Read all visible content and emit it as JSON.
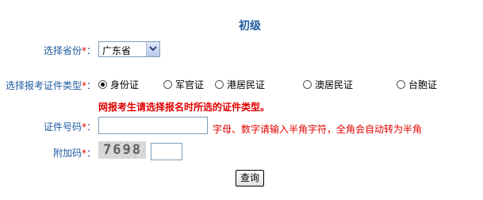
{
  "title": "初级",
  "province": {
    "label": "选择省份",
    "required_mark": "*",
    "colon": "：",
    "value": "广东省"
  },
  "id_type": {
    "label": "选择报考证件类型",
    "required_mark": "*",
    "colon": "：",
    "options": [
      {
        "label": "身份证",
        "selected": true
      },
      {
        "label": "军官证",
        "selected": false
      },
      {
        "label": "港居民证",
        "selected": false
      },
      {
        "label": "澳居民证",
        "selected": false
      },
      {
        "label": "台胞证",
        "selected": false
      }
    ],
    "warning": "网报考生请选择报名时所选的证件类型。"
  },
  "id_number": {
    "label": "证件号码",
    "required_mark": "*",
    "colon": "：",
    "value": "",
    "hint": "字母、数字请输入半角字符，全角会自动转为半角"
  },
  "captcha": {
    "label": "附加码",
    "required_mark": "*",
    "colon": "：",
    "image_text": "7698",
    "value": ""
  },
  "submit_label": "查询"
}
